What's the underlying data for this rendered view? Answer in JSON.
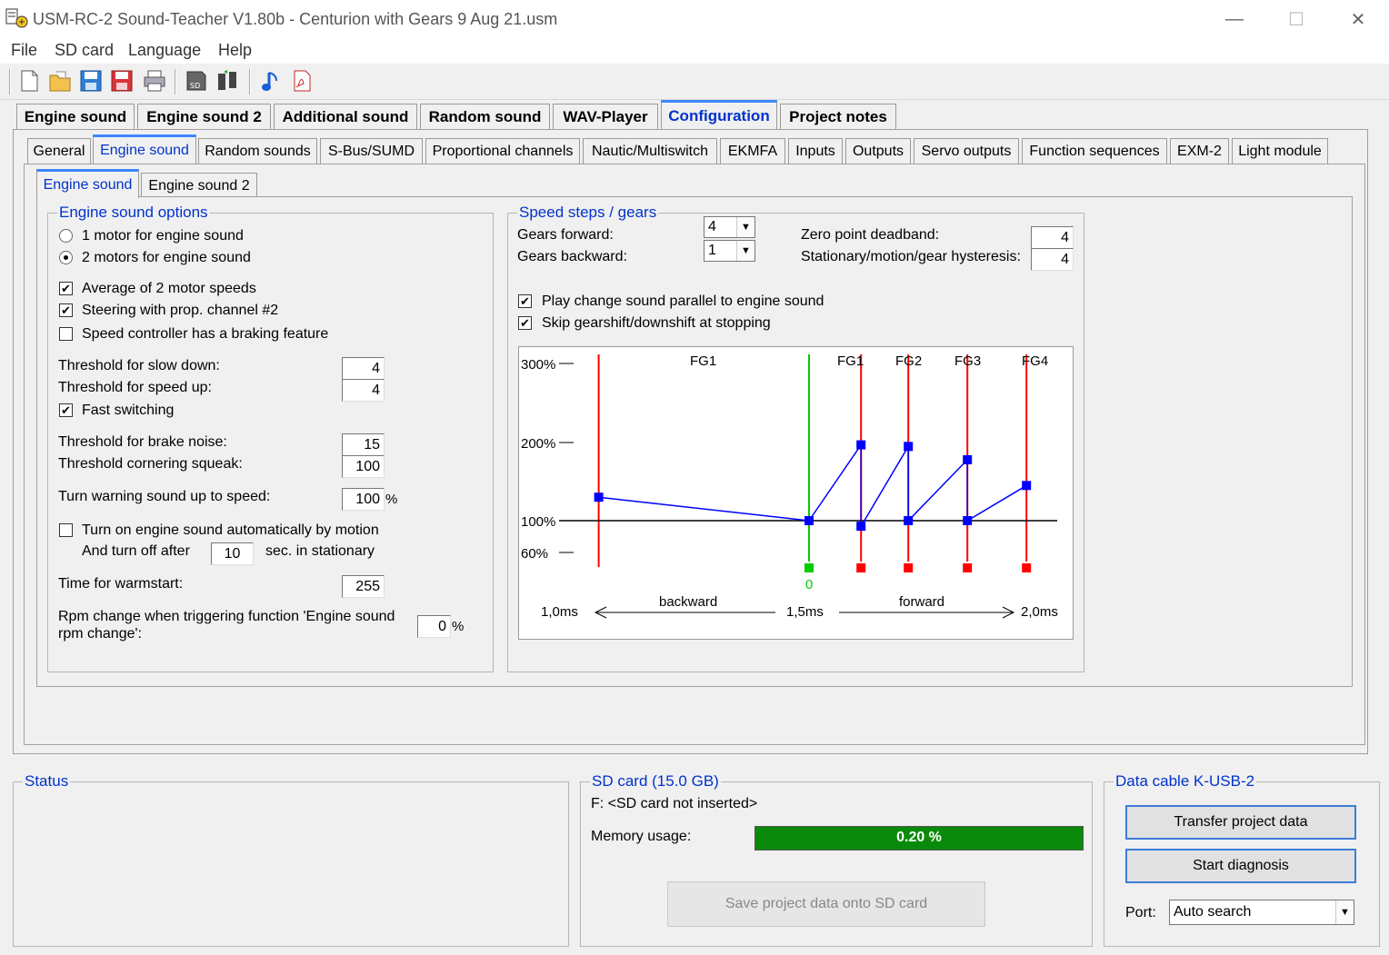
{
  "window": {
    "title": "USM-RC-2 Sound-Teacher V1.80b - Centurion with Gears 9 Aug 21.usm",
    "minimize": "—",
    "maximize": "☐",
    "close": "✕"
  },
  "menu": [
    "File",
    "SD card",
    "Language",
    "Help"
  ],
  "toolbar": [
    "new-file",
    "open-folder",
    "save",
    "save-as",
    "print",
    "sd-card",
    "transfer",
    "sound-note",
    "pdf"
  ],
  "main_tabs": [
    "Engine sound",
    "Engine sound 2",
    "Additional sound",
    "Random sound",
    "WAV-Player",
    "Configuration",
    "Project notes"
  ],
  "main_tab_active": "Configuration",
  "config_tabs": [
    "General",
    "Engine sound",
    "Random sounds",
    "S-Bus/SUMD",
    "Proportional channels",
    "Nautic/Multiswitch",
    "EKMFA",
    "Inputs",
    "Outputs",
    "Servo outputs",
    "Function sequences",
    "EXM-2",
    "Light module"
  ],
  "config_tab_active": "Engine sound",
  "sub_tabs": [
    "Engine sound",
    "Engine sound 2"
  ],
  "sub_tab_active": "Engine sound",
  "engine_options": {
    "legend": "Engine sound options",
    "radio_1motor": "1 motor for engine sound",
    "radio_2motors": "2 motors for engine sound",
    "chk_average": "Average of 2 motor speeds",
    "chk_steering": "Steering with prop. channel #2",
    "chk_braking": "Speed controller has a braking feature",
    "thr_slow_label": "Threshold for slow down:",
    "thr_slow": "4",
    "thr_speed_label": "Threshold for speed up:",
    "thr_speed": "4",
    "chk_fast": "Fast switching",
    "thr_brake_label": "Threshold for brake noise:",
    "thr_brake": "15",
    "thr_corner_label": "Threshold cornering squeak:",
    "thr_corner": "100",
    "turn_warn_label": "Turn warning sound up to speed:",
    "turn_warn": "100",
    "turn_warn_unit": "%",
    "chk_auto": "Turn on engine sound automatically by motion",
    "turn_off_label": "And turn off after",
    "turn_off": "10",
    "turn_off_unit": "sec. in stationary",
    "warmstart_label": "Time for warmstart:",
    "warmstart": "255",
    "rpm_label_1": "Rpm change when triggering function 'Engine sound",
    "rpm_label_2": "rpm change':",
    "rpm": "0",
    "rpm_unit": "%"
  },
  "speed_steps": {
    "legend": "Speed steps / gears",
    "gears_fwd_label": "Gears forward:",
    "gears_fwd": "4",
    "gears_bwd_label": "Gears backward:",
    "gears_bwd": "1",
    "deadband_label": "Zero point deadband:",
    "deadband": "4",
    "hysteresis_label": "Stationary/motion/gear hysteresis:",
    "hysteresis": "4",
    "chk_parallel": "Play change sound parallel to engine sound",
    "chk_skip": "Skip gearshift/downshift at stopping"
  },
  "chart_data": {
    "type": "line",
    "y_ticks": [
      "300%",
      "200%",
      "100%",
      "60%"
    ],
    "gear_labels": [
      "FG1",
      "FG1",
      "FG2",
      "FG3",
      "FG4"
    ],
    "zero_label": "0",
    "x_labels": {
      "left": "1,0ms",
      "mid": "1,5ms",
      "right": "2,0ms",
      "backward": "backward",
      "forward": "forward"
    },
    "points": [
      {
        "x": -0.89,
        "y": 130
      },
      {
        "x": 0.0,
        "y": 100
      },
      {
        "x": 0.22,
        "y": 197
      },
      {
        "x": 0.22,
        "y": 93
      },
      {
        "x": 0.42,
        "y": 195
      },
      {
        "x": 0.42,
        "y": 100
      },
      {
        "x": 0.67,
        "y": 178
      },
      {
        "x": 0.67,
        "y": 100
      },
      {
        "x": 0.92,
        "y": 145
      }
    ],
    "gear_lines": [
      -0.89,
      0.0,
      0.22,
      0.42,
      0.67,
      0.92
    ],
    "colors": {
      "line": "#0000ff",
      "gear": "#ff0000",
      "neutral": "#00cc00",
      "axis": "#000000"
    }
  },
  "status": {
    "legend": "Status"
  },
  "sdcard": {
    "legend": "SD card (15.0 GB)",
    "state": "F: <SD card not inserted>",
    "mem_label": "Memory usage:",
    "mem_value": "0.20 %",
    "save_button": "Save project data onto SD card"
  },
  "cable": {
    "legend": "Data cable K-USB-2",
    "transfer_button": "Transfer project data",
    "diagnosis_button": "Start diagnosis",
    "port_label": "Port:",
    "port_value": "Auto search"
  }
}
